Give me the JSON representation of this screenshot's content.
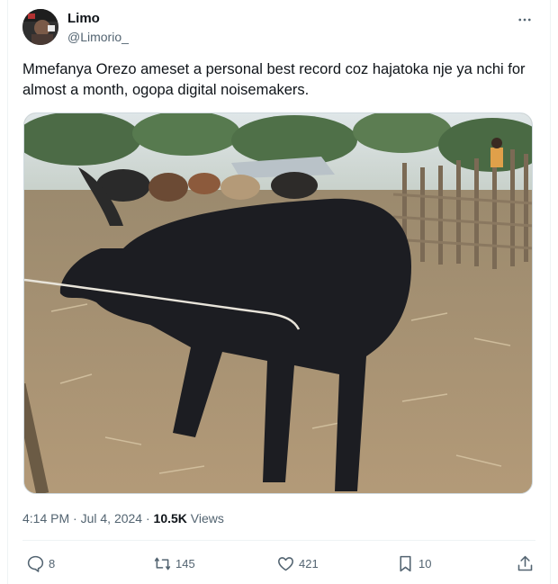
{
  "author": {
    "display_name": "Limo",
    "handle": "@Limorio_"
  },
  "tweet": {
    "text": "Mmefanya Orezo ameset a personal best record coz hajatoka nje ya nchi for almost a month, ogopa digital noisemakers."
  },
  "media": {
    "kind": "photo",
    "subject": "black bull tied with rope at livestock market"
  },
  "meta": {
    "time": "4:14 PM",
    "separator": " · ",
    "date": "Jul 4, 2024",
    "views_count": "10.5K",
    "views_label": "Views"
  },
  "actions": {
    "reply_count": "8",
    "retweet_count": "145",
    "like_count": "421",
    "bookmark_count": "10"
  },
  "icons": {
    "more": "more-horizontal-icon",
    "reply": "reply-icon",
    "retweet": "retweet-icon",
    "like": "heart-icon",
    "bookmark": "bookmark-icon",
    "share": "share-icon"
  },
  "colors": {
    "text_primary": "#0f1419",
    "text_secondary": "#536471",
    "border": "#cfd9de"
  }
}
